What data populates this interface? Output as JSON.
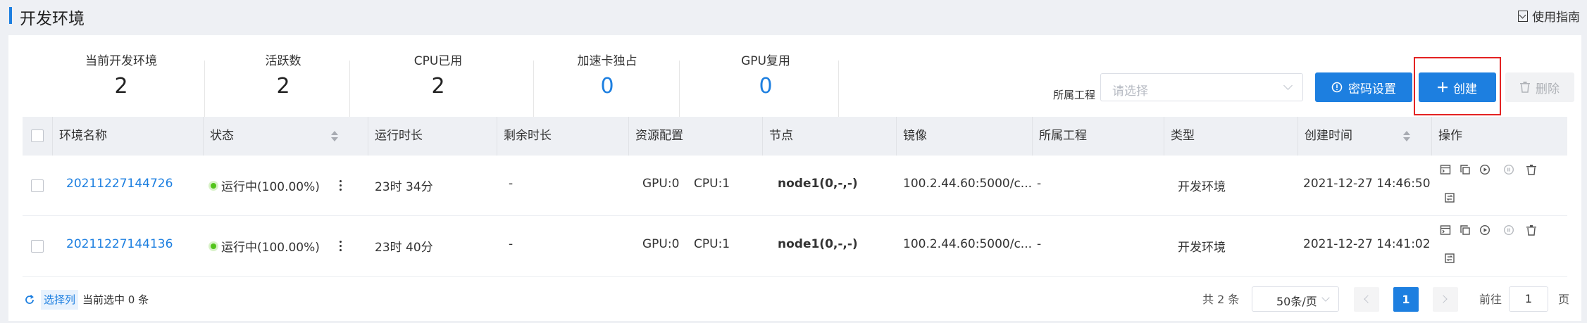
{
  "page": {
    "title": "开发环境",
    "guide_label": "使用指南"
  },
  "stats": [
    {
      "label": "当前开发环境",
      "value": "2"
    },
    {
      "label": "活跃数",
      "value": "2"
    },
    {
      "label": "CPU已用",
      "value": "2"
    },
    {
      "label": "加速卡独占",
      "value": "0"
    },
    {
      "label": "GPU复用",
      "value": "0"
    }
  ],
  "filter": {
    "label": "所属工程",
    "placeholder": "请选择"
  },
  "toolbar": {
    "password_label": "密码设置",
    "create_label": "创建",
    "delete_label": "删除"
  },
  "table": {
    "columns": [
      "环境名称",
      "状态",
      "运行时长",
      "剩余时长",
      "资源配置",
      "节点",
      "镜像",
      "所属工程",
      "类型",
      "创建时间",
      "操作"
    ],
    "rows": [
      {
        "name": "20211227144726",
        "status": "运行中(100.00%)",
        "runtime": "23时 34分",
        "remaining": "-",
        "gpu": "GPU:0",
        "cpu": "CPU:1",
        "node": "node1(0,-,-)",
        "image": "100.2.44.60:5000/c...",
        "project": "-",
        "type": "开发环境",
        "created": "2021-12-27 14:46:50"
      },
      {
        "name": "20211227144136",
        "status": "运行中(100.00%)",
        "runtime": "23时 40分",
        "remaining": "-",
        "gpu": "GPU:0",
        "cpu": "CPU:1",
        "node": "node1(0,-,-)",
        "image": "100.2.44.60:5000/c...",
        "project": "-",
        "type": "开发环境",
        "created": "2021-12-27 14:41:02"
      }
    ]
  },
  "footer": {
    "select_columns_label": "选择列",
    "selected_count_text": "当前选中 0 条",
    "total_text": "共 2 条",
    "page_size": "50条/页",
    "current_page": "1",
    "goto_label": "前往",
    "goto_value": "1",
    "goto_suffix": "页"
  },
  "colors": {
    "primary": "#1d7fe0",
    "running": "#52c41a",
    "highlight": "#e32222"
  }
}
